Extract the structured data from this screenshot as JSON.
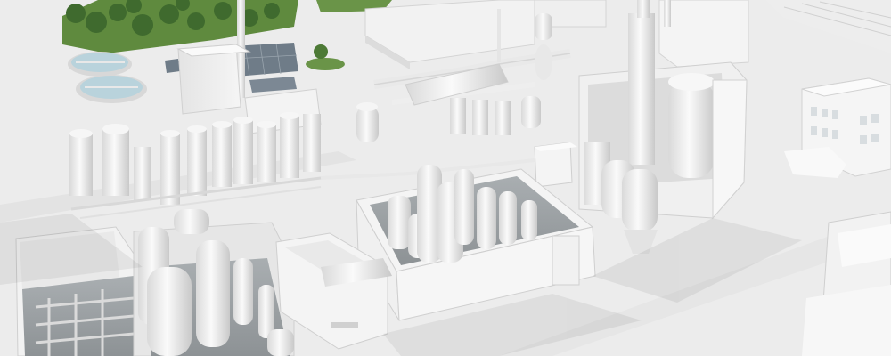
{
  "scene": {
    "subject": "industrial-plant-model",
    "palette": {
      "ground": "#ececec",
      "structure": "#f4f4f4",
      "shadow": "#cfcfcf",
      "deep_shadow": "#9ea3a6",
      "grass": "#5f8a3e",
      "tree": "#3f6a2e",
      "water": "#b9d3dc",
      "solar": "#6f7c88"
    }
  }
}
